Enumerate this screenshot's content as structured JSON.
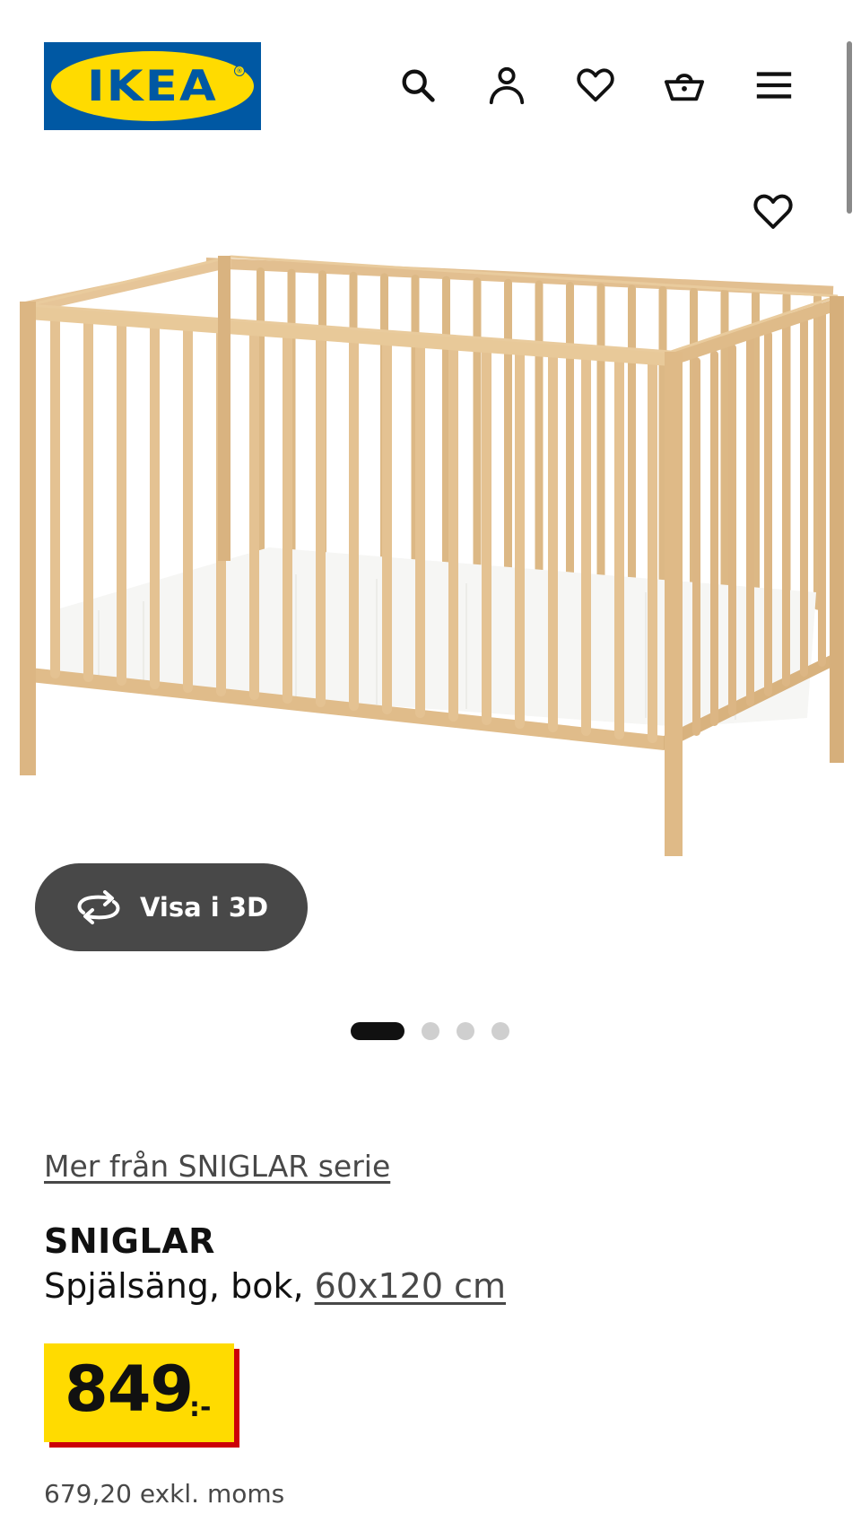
{
  "header": {
    "logo_text": "IKEA",
    "icons": [
      "search-icon",
      "user-icon",
      "heart-icon",
      "basket-icon",
      "menu-icon"
    ]
  },
  "product": {
    "favorite_icon": "heart-icon",
    "view3d_label": "Visa i 3D",
    "view3d_icon": "rotate-icon",
    "carousel": {
      "total": 4,
      "active": 1
    },
    "series_link": "Mer från SNIGLAR serie",
    "name": "SNIGLAR",
    "description": "Spjälsäng, bok, ",
    "size_link": "60x120 cm",
    "price": "849",
    "price_suffix": ":-",
    "price_excl_vat": "679,20 exkl. moms"
  },
  "colors": {
    "brand_blue": "#0058a3",
    "brand_yellow": "#ffdb00",
    "price_red": "#cc0008",
    "button_gray": "#484848",
    "wood": "#e3c293"
  }
}
